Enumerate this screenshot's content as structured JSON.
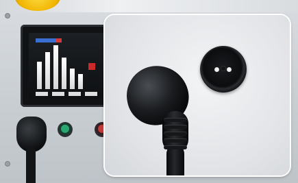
{
  "scene": {
    "description_free": true,
    "accent_colors": {
      "yellow": "#f1b400",
      "green": "#29a770",
      "red": "#c43b3b",
      "blue": "#3a6fd1"
    },
    "icons": [
      "power-plug",
      "power-socket",
      "control-screen",
      "green-indicator",
      "red-indicator"
    ]
  }
}
